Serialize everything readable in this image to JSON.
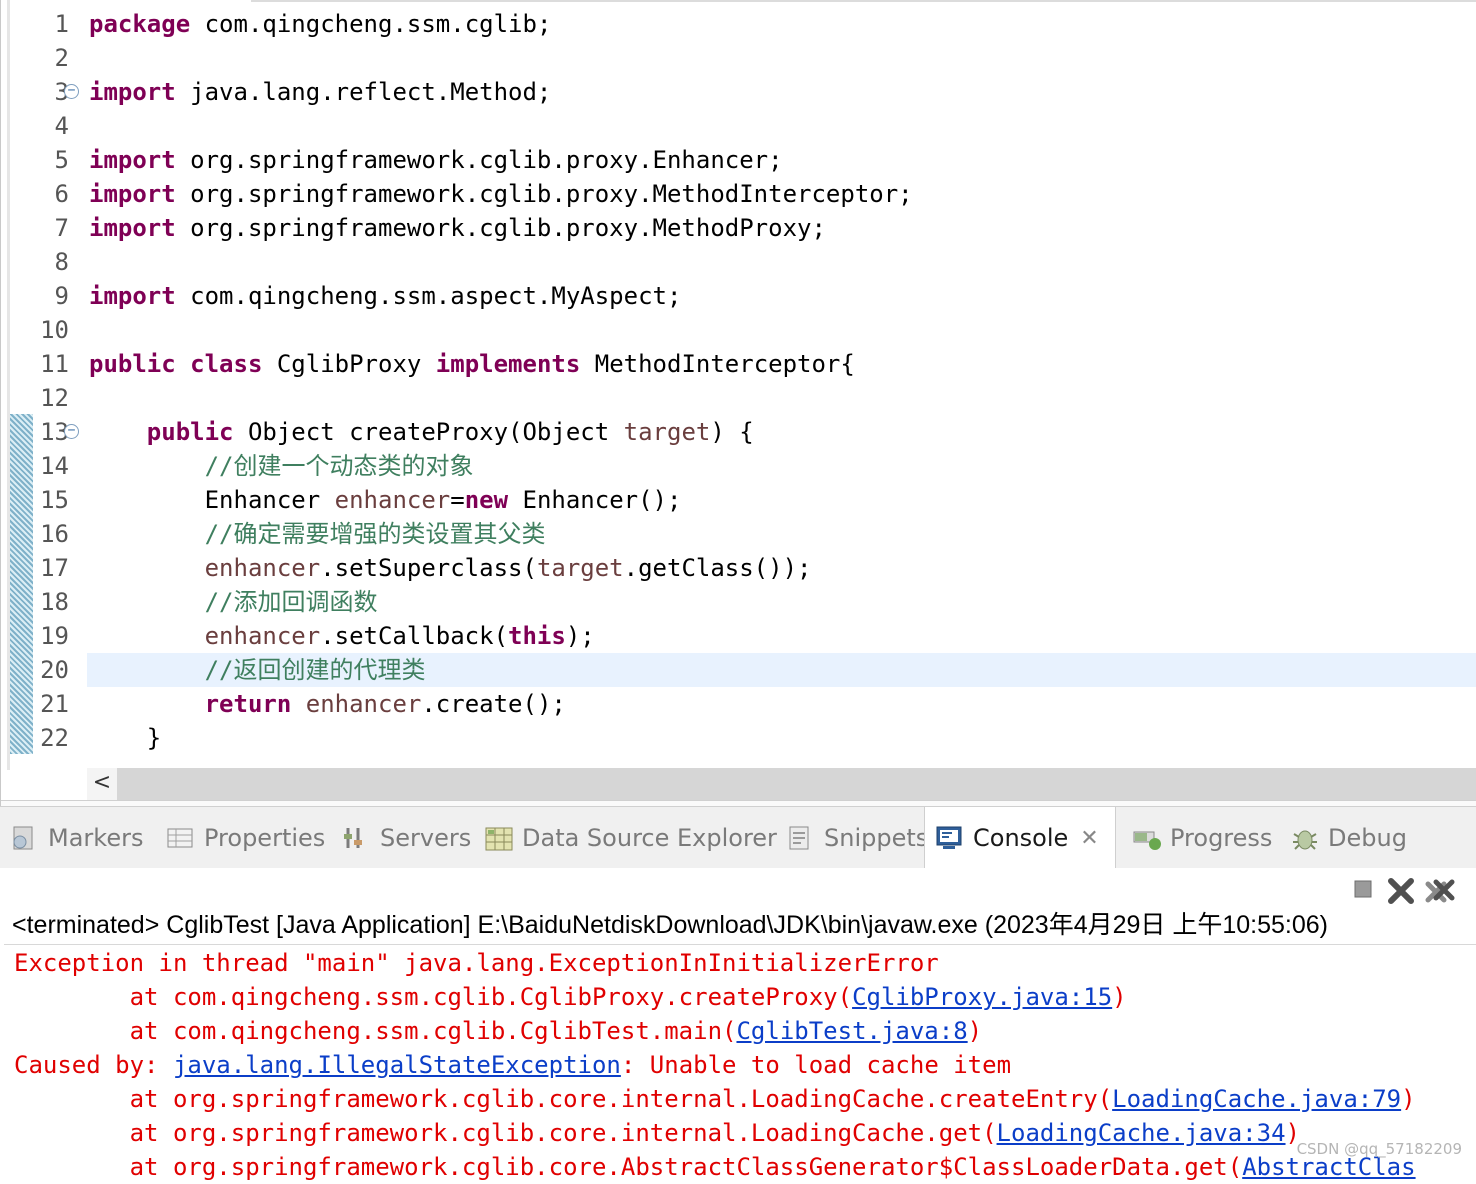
{
  "editor": {
    "lines": [
      {
        "n": "1",
        "segs": [
          {
            "t": "package",
            "c": "kw"
          },
          {
            "t": " com.qingcheng.ssm.cglib;",
            "c": ""
          }
        ]
      },
      {
        "n": "2",
        "segs": []
      },
      {
        "n": "3",
        "fold": true,
        "segs": [
          {
            "t": "import",
            "c": "kw"
          },
          {
            "t": " java.lang.reflect.Method;",
            "c": ""
          }
        ]
      },
      {
        "n": "4",
        "segs": []
      },
      {
        "n": "5",
        "segs": [
          {
            "t": "import",
            "c": "kw"
          },
          {
            "t": " org.springframework.cglib.proxy.Enhancer;",
            "c": ""
          }
        ]
      },
      {
        "n": "6",
        "segs": [
          {
            "t": "import",
            "c": "kw"
          },
          {
            "t": " org.springframework.cglib.proxy.MethodInterceptor;",
            "c": ""
          }
        ]
      },
      {
        "n": "7",
        "segs": [
          {
            "t": "import",
            "c": "kw"
          },
          {
            "t": " org.springframework.cglib.proxy.MethodProxy;",
            "c": ""
          }
        ]
      },
      {
        "n": "8",
        "segs": []
      },
      {
        "n": "9",
        "segs": [
          {
            "t": "import",
            "c": "kw"
          },
          {
            "t": " com.qingcheng.ssm.aspect.MyAspect;",
            "c": ""
          }
        ]
      },
      {
        "n": "10",
        "segs": []
      },
      {
        "n": "11",
        "segs": [
          {
            "t": "public",
            "c": "kw"
          },
          {
            "t": " ",
            "c": ""
          },
          {
            "t": "class",
            "c": "kw"
          },
          {
            "t": " CglibProxy ",
            "c": ""
          },
          {
            "t": "implements",
            "c": "kw"
          },
          {
            "t": " MethodInterceptor{",
            "c": ""
          }
        ]
      },
      {
        "n": "12",
        "segs": []
      },
      {
        "n": "13",
        "fold": true,
        "segs": [
          {
            "t": "    ",
            "c": ""
          },
          {
            "t": "public",
            "c": "kw"
          },
          {
            "t": " Object createProxy(Object ",
            "c": ""
          },
          {
            "t": "target",
            "c": "var"
          },
          {
            "t": ") {",
            "c": ""
          }
        ]
      },
      {
        "n": "14",
        "segs": [
          {
            "t": "        ",
            "c": ""
          },
          {
            "t": "//",
            "c": "cmslash"
          },
          {
            "t": "创建一个动态类的对象",
            "c": "cm"
          }
        ]
      },
      {
        "n": "15",
        "segs": [
          {
            "t": "        Enhancer ",
            "c": ""
          },
          {
            "t": "enhancer",
            "c": "var"
          },
          {
            "t": "=",
            "c": ""
          },
          {
            "t": "new",
            "c": "kw"
          },
          {
            "t": " Enhancer();",
            "c": ""
          }
        ]
      },
      {
        "n": "16",
        "segs": [
          {
            "t": "        ",
            "c": ""
          },
          {
            "t": "//",
            "c": "cmslash"
          },
          {
            "t": "确定需要增强的类设置其父类",
            "c": "cm"
          }
        ]
      },
      {
        "n": "17",
        "segs": [
          {
            "t": "        ",
            "c": ""
          },
          {
            "t": "enhancer",
            "c": "var"
          },
          {
            "t": ".setSuperclass(",
            "c": ""
          },
          {
            "t": "target",
            "c": "var"
          },
          {
            "t": ".getClass());",
            "c": ""
          }
        ]
      },
      {
        "n": "18",
        "segs": [
          {
            "t": "        ",
            "c": ""
          },
          {
            "t": "//",
            "c": "cmslash"
          },
          {
            "t": "添加回调函数",
            "c": "cm"
          }
        ]
      },
      {
        "n": "19",
        "segs": [
          {
            "t": "        ",
            "c": ""
          },
          {
            "t": "enhancer",
            "c": "var"
          },
          {
            "t": ".setCallback(",
            "c": ""
          },
          {
            "t": "this",
            "c": "kw"
          },
          {
            "t": ");",
            "c": ""
          }
        ]
      },
      {
        "n": "20",
        "current": true,
        "segs": [
          {
            "t": "        ",
            "c": ""
          },
          {
            "t": "//",
            "c": "cmslash"
          },
          {
            "t": "返回创建的代理类",
            "c": "cm"
          }
        ]
      },
      {
        "n": "21",
        "segs": [
          {
            "t": "        ",
            "c": ""
          },
          {
            "t": "return",
            "c": "kw"
          },
          {
            "t": " ",
            "c": ""
          },
          {
            "t": "enhancer",
            "c": "var"
          },
          {
            "t": ".create();",
            "c": ""
          }
        ]
      },
      {
        "n": "22",
        "segs": [
          {
            "t": "    }",
            "c": ""
          }
        ]
      }
    ],
    "scroll_left_glyph": "<"
  },
  "tabs": [
    {
      "label": "Markers",
      "icon": "markers-icon",
      "active": false
    },
    {
      "label": "Properties",
      "icon": "properties-icon",
      "active": false
    },
    {
      "label": "Servers",
      "icon": "servers-icon",
      "active": false
    },
    {
      "label": "Data Source Explorer",
      "icon": "data-source-explorer-icon",
      "active": false
    },
    {
      "label": "Snippets",
      "icon": "snippets-icon",
      "active": false
    },
    {
      "label": "Console",
      "icon": "console-icon",
      "active": true,
      "close": "✕"
    },
    {
      "label": "Progress",
      "icon": "progress-icon",
      "active": false
    },
    {
      "label": "Debug",
      "icon": "debug-icon",
      "active": false
    }
  ],
  "console": {
    "terminated_line": "<terminated> CglibTest [Java Application] E:\\BaiduNetdiskDownload\\JDK\\bin\\javaw.exe (2023年4月29日 上午10:55:06)",
    "output": [
      [
        {
          "t": "Exception in thread \"main\" java.lang.ExceptionInInitializerError"
        }
      ],
      [
        {
          "t": "        at com.qingcheng.ssm.cglib.CglibProxy.createProxy("
        },
        {
          "t": "CglibProxy.java:15",
          "link": true
        },
        {
          "t": ")"
        }
      ],
      [
        {
          "t": "        at com.qingcheng.ssm.cglib.CglibTest.main("
        },
        {
          "t": "CglibTest.java:8",
          "link": true
        },
        {
          "t": ")"
        }
      ],
      [
        {
          "t": "Caused by: "
        },
        {
          "t": "java.lang.IllegalStateException",
          "link": true
        },
        {
          "t": ": Unable to load cache item"
        }
      ],
      [
        {
          "t": "        at org.springframework.cglib.core.internal.LoadingCache.createEntry("
        },
        {
          "t": "LoadingCache.java:79",
          "link": true
        },
        {
          "t": ")"
        }
      ],
      [
        {
          "t": "        at org.springframework.cglib.core.internal.LoadingCache.get("
        },
        {
          "t": "LoadingCache.java:34",
          "link": true
        },
        {
          "t": ")"
        }
      ],
      [
        {
          "t": "        at org.springframework.cglib.core.AbstractClassGenerator$ClassLoaderData.get("
        },
        {
          "t": "AbstractClas",
          "link": true
        }
      ]
    ],
    "toolbar": [
      {
        "name": "terminate-button",
        "icon": "stop-icon"
      },
      {
        "name": "remove-launch-button",
        "icon": "remove-icon"
      },
      {
        "name": "remove-all-terminated-button",
        "icon": "remove-all-icon"
      }
    ]
  },
  "watermark": "CSDN @qq_57182209",
  "colors": {
    "keyword": "#7f0055",
    "comment": "#3f7f5f",
    "variable": "#6a3e3e",
    "error": "#e00000",
    "link": "#0b3ec8",
    "current_line": "#e8f2fe"
  }
}
